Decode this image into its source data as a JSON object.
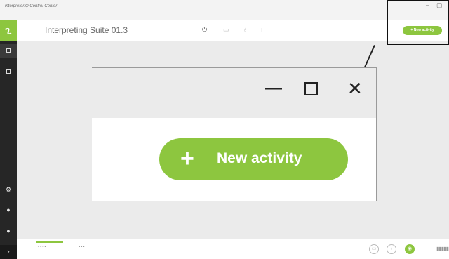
{
  "window": {
    "title": "interpreterIQ Control Center",
    "minimize": "–",
    "maximize": "▢"
  },
  "header": {
    "app_title": "Interpreting Suite 01.3",
    "new_activity_label": "New activity",
    "new_activity_plus": "+"
  },
  "zoom": {
    "minimize": "—",
    "close": "✕",
    "new_activity_plus": "+",
    "new_activity_label": "New activity"
  },
  "sidebar": {
    "logo": "ጊ",
    "expand": "›"
  },
  "colors": {
    "accent": "#8dc63f",
    "sidebar_bg": "#262626",
    "main_bg": "#ebebeb"
  }
}
